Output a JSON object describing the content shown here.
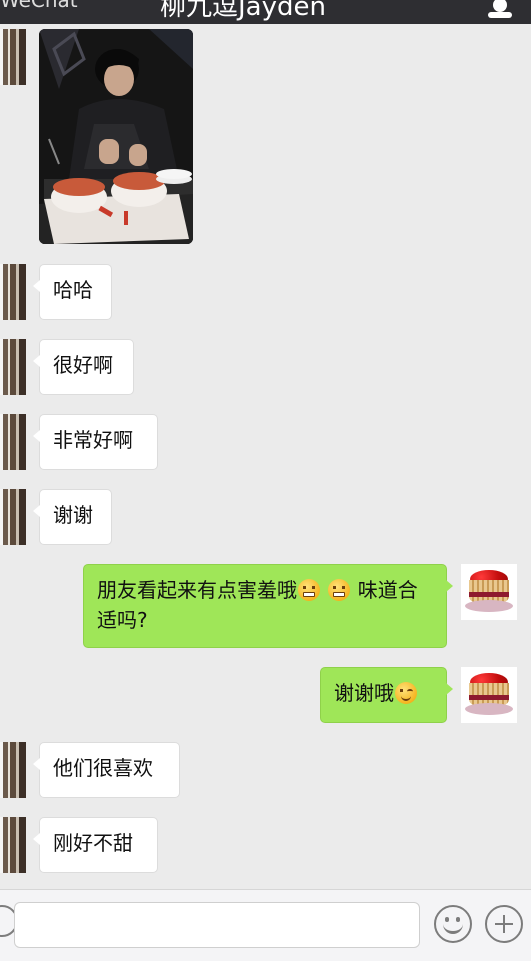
{
  "header": {
    "back_label": "WeChat",
    "title": "柳九逗Jayden",
    "profile_icon": "person-icon"
  },
  "messages": [
    {
      "from": "friend",
      "type": "image",
      "content": "photo-of-man-with-cake"
    },
    {
      "from": "friend",
      "type": "text",
      "text": "哈哈"
    },
    {
      "from": "friend",
      "type": "text",
      "text": "很好啊"
    },
    {
      "from": "friend",
      "type": "text",
      "text": "非常好啊"
    },
    {
      "from": "friend",
      "type": "text",
      "text": "谢谢"
    },
    {
      "from": "me",
      "type": "text",
      "text_a": "朋友看起来有点害羞哦",
      "emoji_a": "grimace-emoji",
      "emoji_b": "grimace-emoji",
      "text_b": "味道合适吗?"
    },
    {
      "from": "me",
      "type": "text",
      "text_a": "谢谢哦",
      "emoji_a": "wink-emoji"
    },
    {
      "from": "friend",
      "type": "text",
      "text": "他们很喜欢"
    },
    {
      "from": "friend",
      "type": "text",
      "text": "刚好不甜"
    }
  ],
  "input_bar": {
    "placeholder": "",
    "voice_icon": "voice-icon",
    "emoji_icon": "emoji-icon",
    "plus_icon": "plus-icon"
  },
  "colors": {
    "outgoing_bubble": "#9fe658",
    "incoming_bubble": "#ffffff",
    "chat_background": "#ebebeb",
    "header_background": "#2e2e32"
  }
}
